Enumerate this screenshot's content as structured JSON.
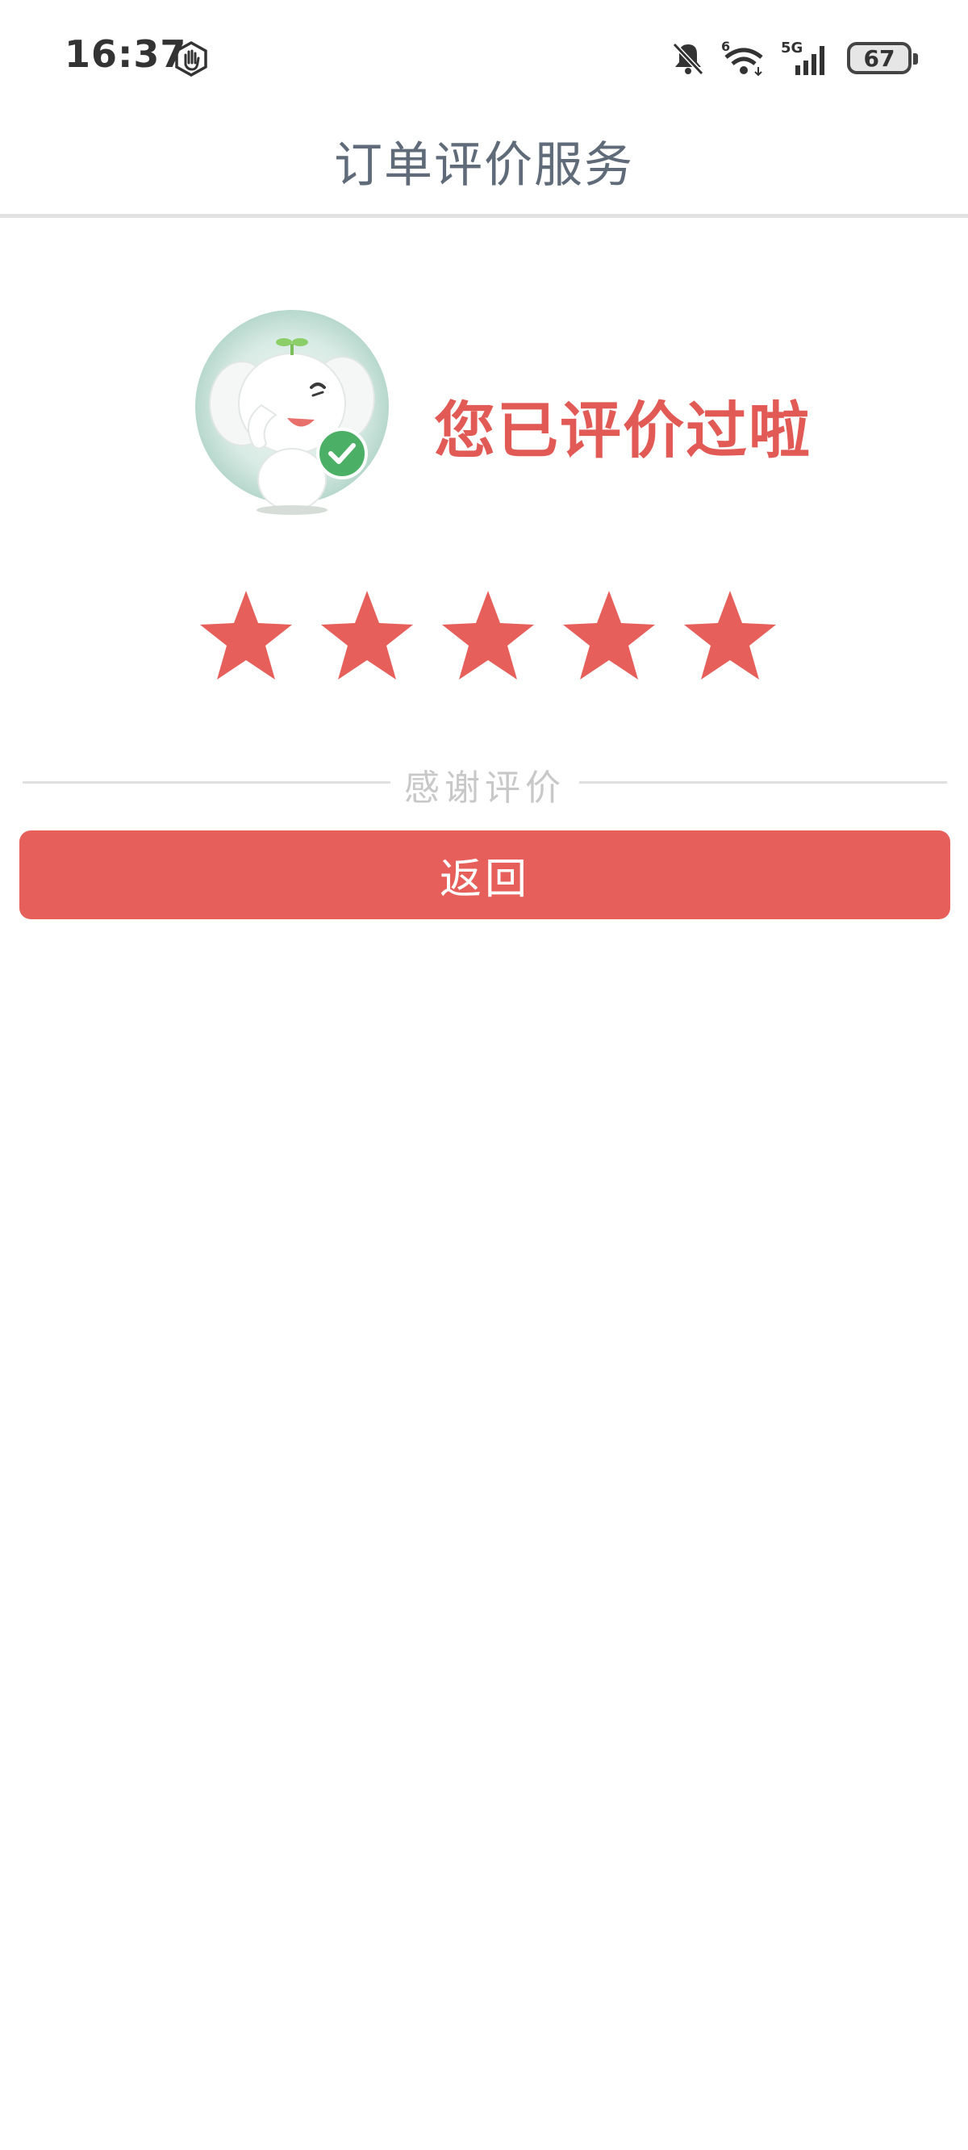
{
  "status_bar": {
    "time": "16:37",
    "battery": "67",
    "icons": [
      "hand-icon",
      "bell-muted-icon",
      "wifi-icon",
      "5g-signal-icon",
      "battery-icon"
    ]
  },
  "header": {
    "title": "订单评价服务"
  },
  "result": {
    "message": "您已评价过啦",
    "rating": 5,
    "max_rating": 5
  },
  "divider": {
    "text": "感谢评价"
  },
  "actions": {
    "back_label": "返回"
  },
  "colors": {
    "accent": "#e65f5b",
    "star": "#e65f5b",
    "title_text": "#5f6b78",
    "muted_text": "#c8c8c8",
    "check_badge": "#4caf66"
  }
}
